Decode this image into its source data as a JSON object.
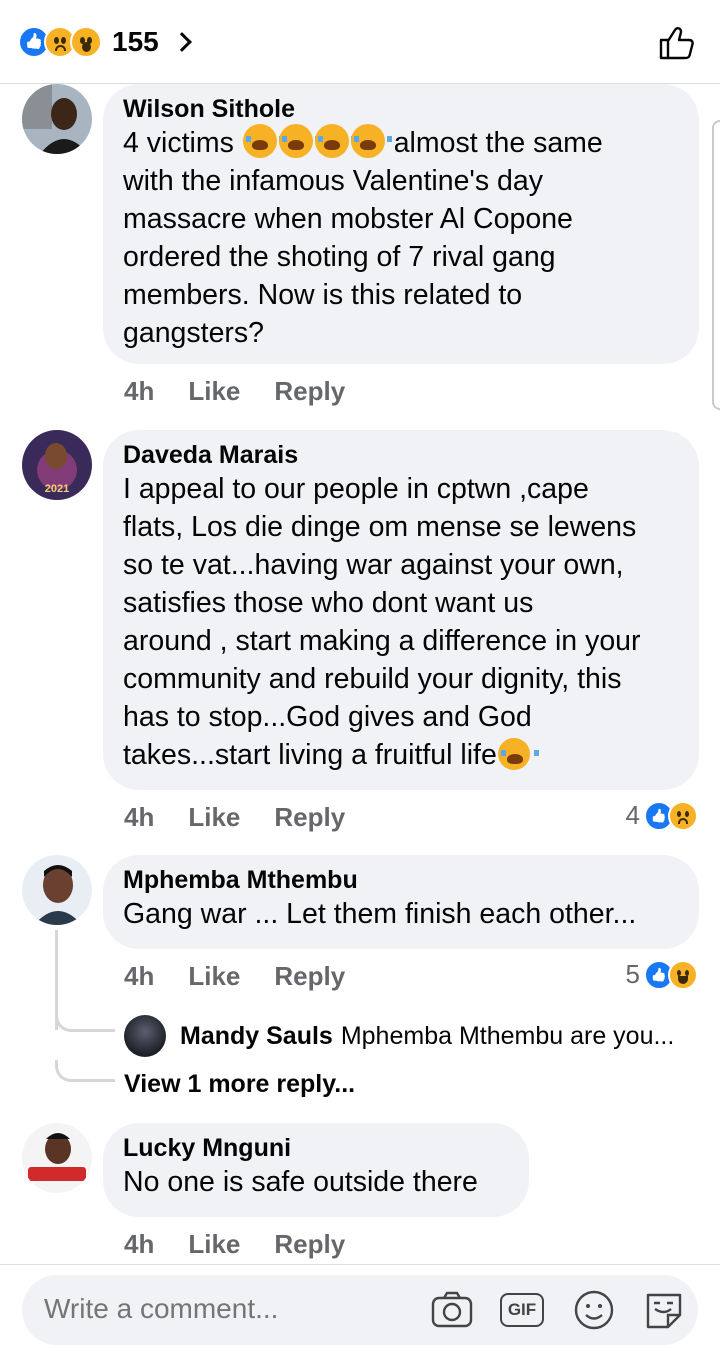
{
  "header": {
    "reaction_count": "155",
    "reaction_icons": [
      "like-icon",
      "sad-icon",
      "wow-icon"
    ]
  },
  "comments": [
    {
      "author": "Wilson Sithole",
      "text_lines": [
        "4 victims",
        "almost the same",
        "with the infamous Valentine's day",
        "massacre when mobster Al Copone",
        "ordered the shoting of 7 rival gang",
        "members. Now is this related to",
        "gangsters?"
      ],
      "time": "4h",
      "like_label": "Like",
      "reply_label": "Reply"
    },
    {
      "author": "Daveda Marais",
      "text_lines": [
        "I appeal to our people in cptwn ,cape",
        "flats, Los die dinge om mense se lewens",
        "so te vat...having war against your own,",
        "satisfies those who dont want us",
        "around , start making a difference in your",
        "community and rebuild your dignity, this",
        "has to stop...God gives and God",
        "takes...start living a fruitful life"
      ],
      "time": "4h",
      "like_label": "Like",
      "reply_label": "Reply",
      "reactions": "4"
    },
    {
      "author": "Mphemba Mthembu",
      "text": "Gang war ... Let them finish each other...",
      "time": "4h",
      "like_label": "Like",
      "reply_label": "Reply",
      "reactions": "5",
      "reply_preview": {
        "author": "Mandy Sauls",
        "text": "Mphemba Mthembu  are you..."
      },
      "view_more": "View 1 more reply..."
    },
    {
      "author": "Lucky Mnguni",
      "text": "No one is safe outside there",
      "time": "4h",
      "like_label": "Like",
      "reply_label": "Reply"
    }
  ],
  "composer": {
    "placeholder": "Write a comment...",
    "tools": [
      "camera-icon",
      "gif-icon",
      "emoji-icon",
      "sticker-icon"
    ],
    "gif_label": "GIF"
  },
  "colors": {
    "like_blue": "#1877f2",
    "bubble_bg": "#f0f2f5",
    "meta_gray": "#65676b",
    "reaction_yellow": "#f7b125"
  }
}
